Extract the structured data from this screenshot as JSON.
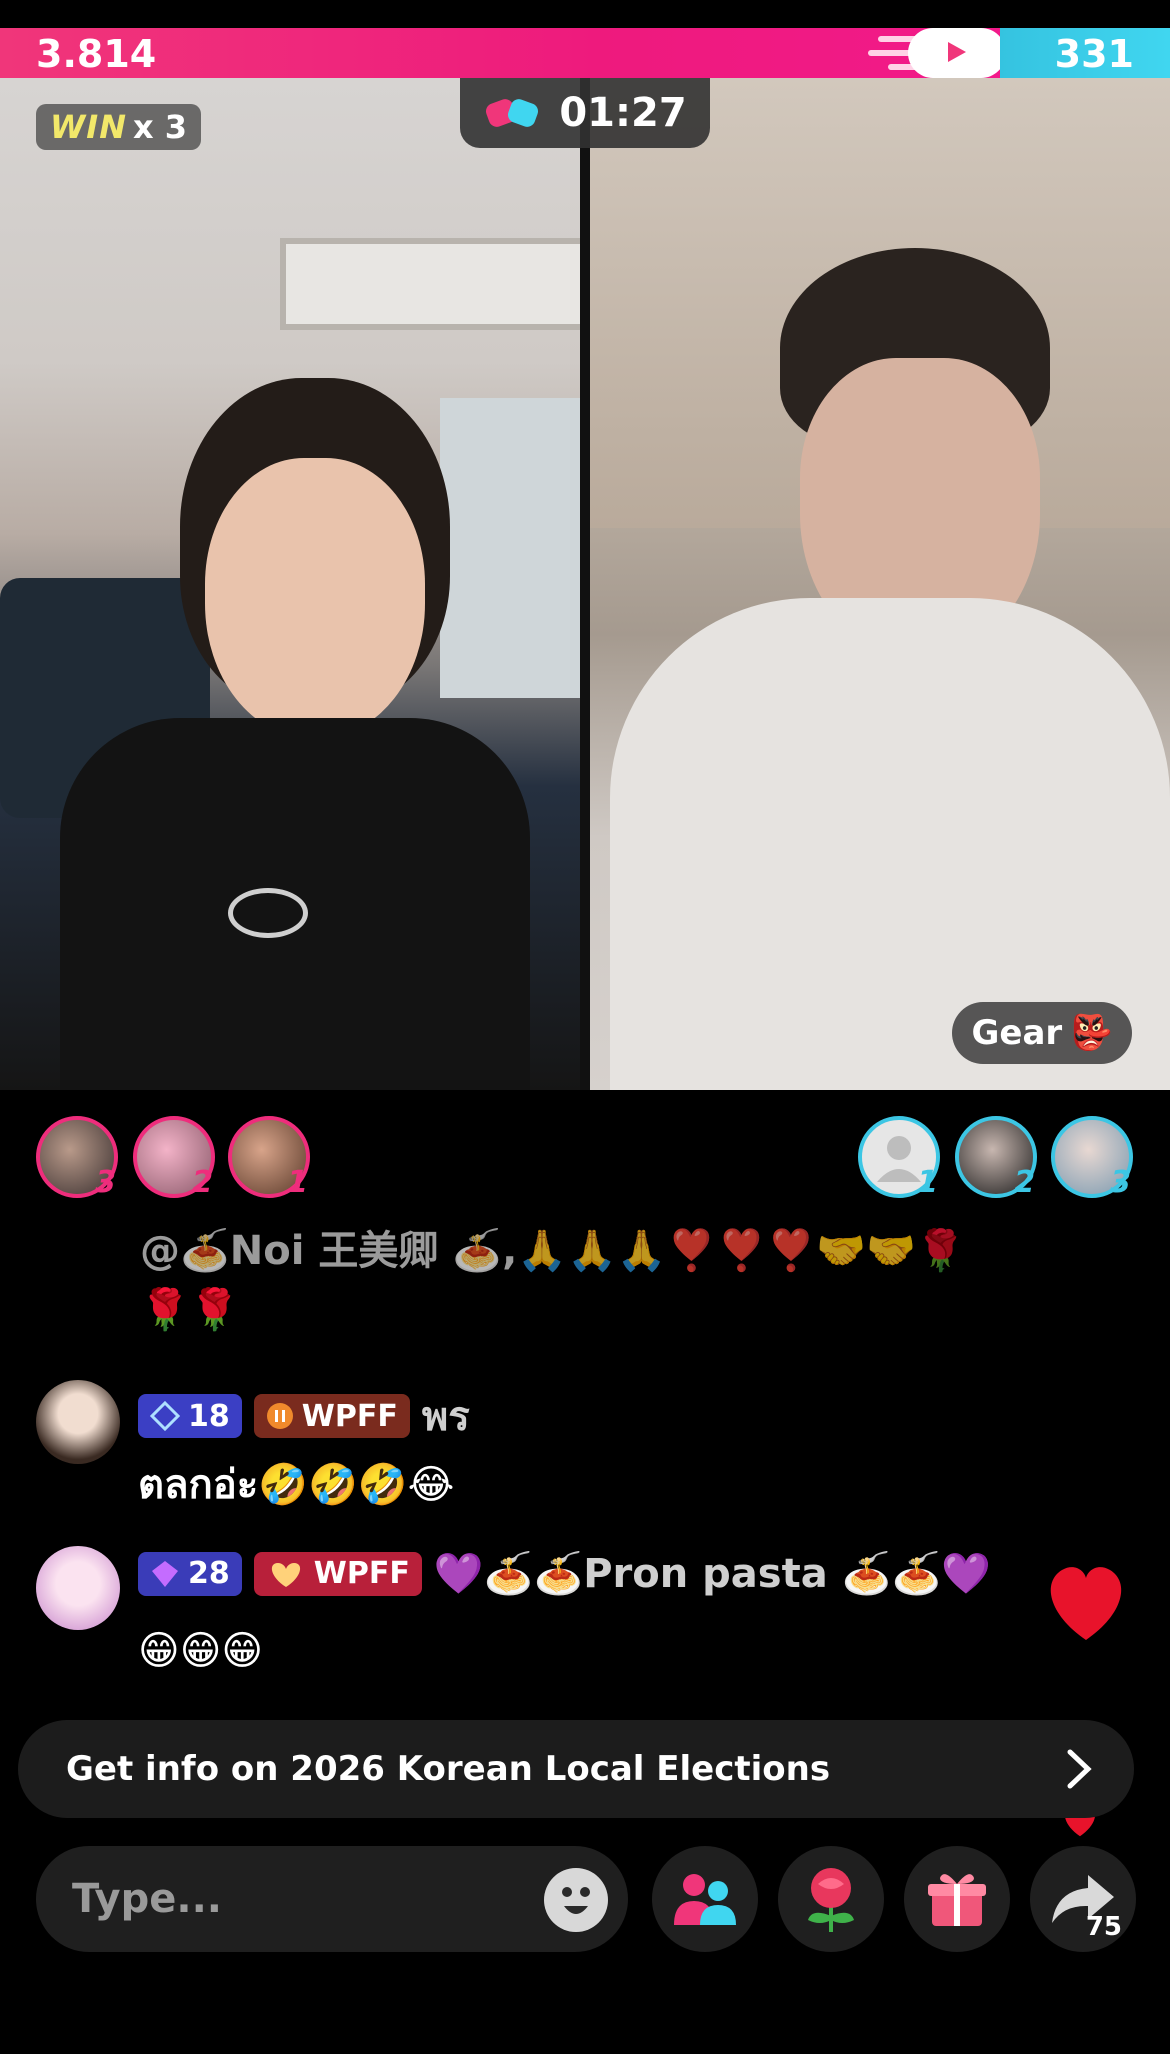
{
  "battle": {
    "left_score": "3.814",
    "right_score": "331",
    "left_fraction": 0.855,
    "win_word": "WIN",
    "win_count": "x 3",
    "timer": "01:27",
    "colors": {
      "left": "#ee1a7d",
      "right": "#40d6f0"
    }
  },
  "opponent": {
    "name": "Gear",
    "emoji": "👺"
  },
  "supporters": {
    "left": [
      {
        "rank": "3"
      },
      {
        "rank": "2"
      },
      {
        "rank": "1"
      }
    ],
    "right": [
      {
        "rank": "1"
      },
      {
        "rank": "2"
      },
      {
        "rank": "3"
      }
    ]
  },
  "chat": [
    {
      "text_line1": "@🍝Noi 王美卿 🍝,🙏🙏🙏❣️❣️❣️🤝🤝🌹",
      "text_line2": "🌹🌹"
    },
    {
      "level": "18",
      "fan_badge": "WPFF",
      "username": "พร",
      "message": "ตลกอ่ะ🤣🤣🤣😂"
    },
    {
      "level": "28",
      "fan_badge": "WPFF",
      "username": "💜🍝🍝Pron pasta 🍝🍝💜",
      "message": "😁😁😁"
    }
  ],
  "info_banner": "Get info on 2026 Korean Local Elections",
  "composer": {
    "placeholder": "Type...",
    "share_count": "75"
  },
  "icons": [
    "score-speed-icon",
    "battle-glove-icon",
    "emoji-icon",
    "guests-icon",
    "rose-gift-icon",
    "gift-box-icon",
    "share-arrow-icon",
    "chevron-right-icon",
    "heart-icon",
    "diamond-level-icon"
  ]
}
